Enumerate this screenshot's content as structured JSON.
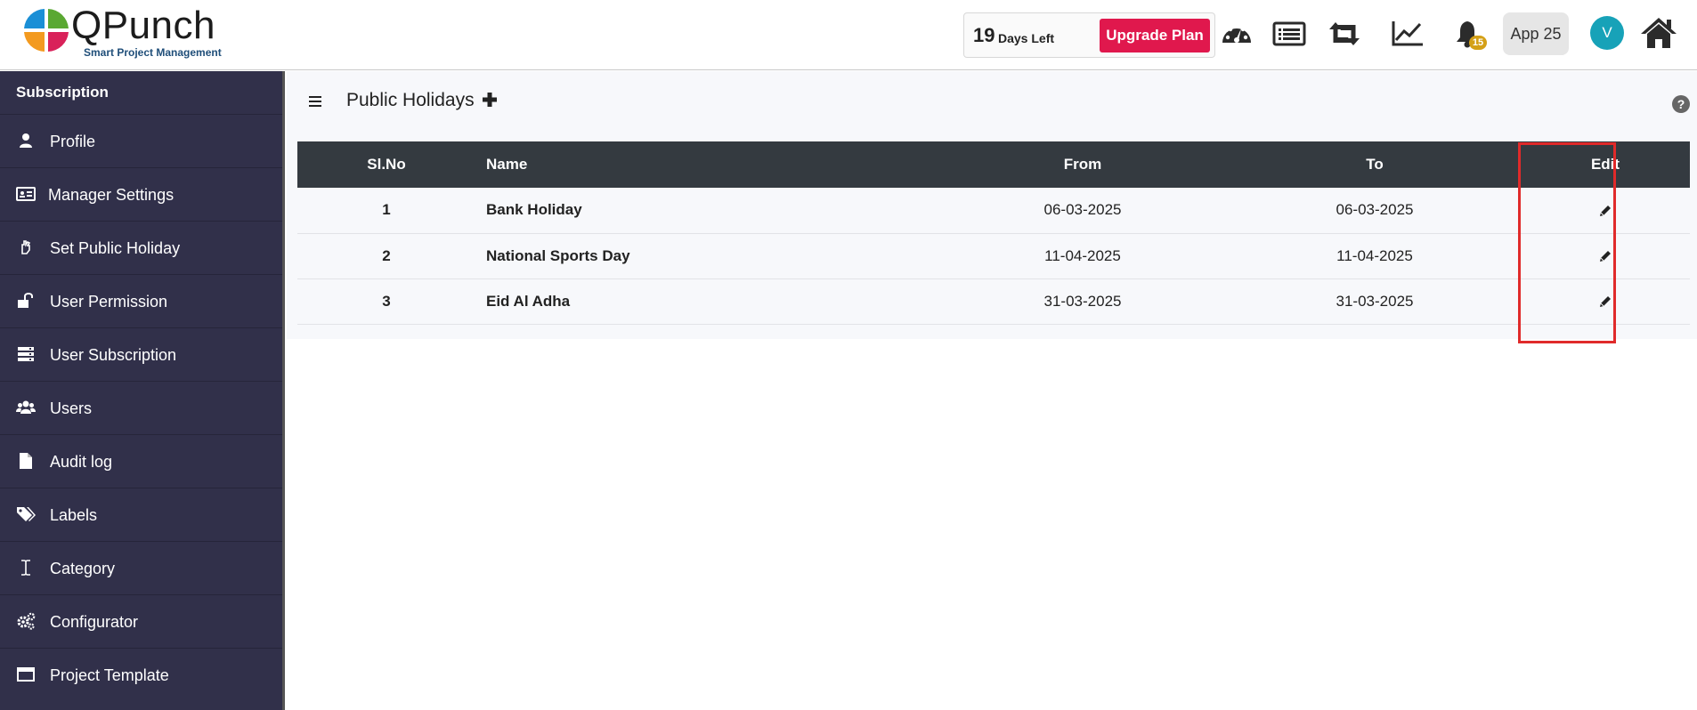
{
  "brand": {
    "name": "QPunch",
    "tagline": "Smart Project Management"
  },
  "header": {
    "trial_days": "19",
    "trial_label": "Days Left",
    "upgrade_label": "Upgrade Plan",
    "notification_count": "15",
    "app_label": "App 25",
    "avatar_initial": "V",
    "icons": [
      "dashboard-icon",
      "list-icon",
      "retweet-icon",
      "chart-line-icon",
      "bell-icon",
      "home-icon"
    ]
  },
  "sidebar": {
    "title": "Subscription",
    "items": [
      {
        "label": "Profile",
        "icon": "user-icon"
      },
      {
        "label": "Manager Settings",
        "icon": "id-card-icon"
      },
      {
        "label": "Set Public Holiday",
        "icon": "hand-icon"
      },
      {
        "label": "User Permission",
        "icon": "unlock-icon"
      },
      {
        "label": "User Subscription",
        "icon": "server-icon"
      },
      {
        "label": "Users",
        "icon": "users-icon"
      },
      {
        "label": "Audit log",
        "icon": "file-icon"
      },
      {
        "label": "Labels",
        "icon": "tags-icon"
      },
      {
        "label": "Category",
        "icon": "text-cursor-icon"
      },
      {
        "label": "Configurator",
        "icon": "cogs-icon"
      },
      {
        "label": "Project Template",
        "icon": "window-icon"
      }
    ]
  },
  "main": {
    "title": "Public Holidays",
    "table": {
      "headers": [
        "Sl.No",
        "Name",
        "From",
        "To",
        "Edit"
      ],
      "rows": [
        {
          "sl": "1",
          "name": "Bank Holiday",
          "from": "06-03-2025",
          "to": "06-03-2025"
        },
        {
          "sl": "2",
          "name": "National Sports Day",
          "from": "11-04-2025",
          "to": "11-04-2025"
        },
        {
          "sl": "3",
          "name": "Eid Al Adha",
          "from": "31-03-2025",
          "to": "31-03-2025"
        }
      ]
    }
  },
  "colors": {
    "sidebar_bg": "#31304a",
    "table_header_bg": "#343a40",
    "upgrade_button": "#e0184d",
    "avatar": "#17a2b8",
    "badge": "#d4a017",
    "highlight_box": "#e02a2a"
  }
}
